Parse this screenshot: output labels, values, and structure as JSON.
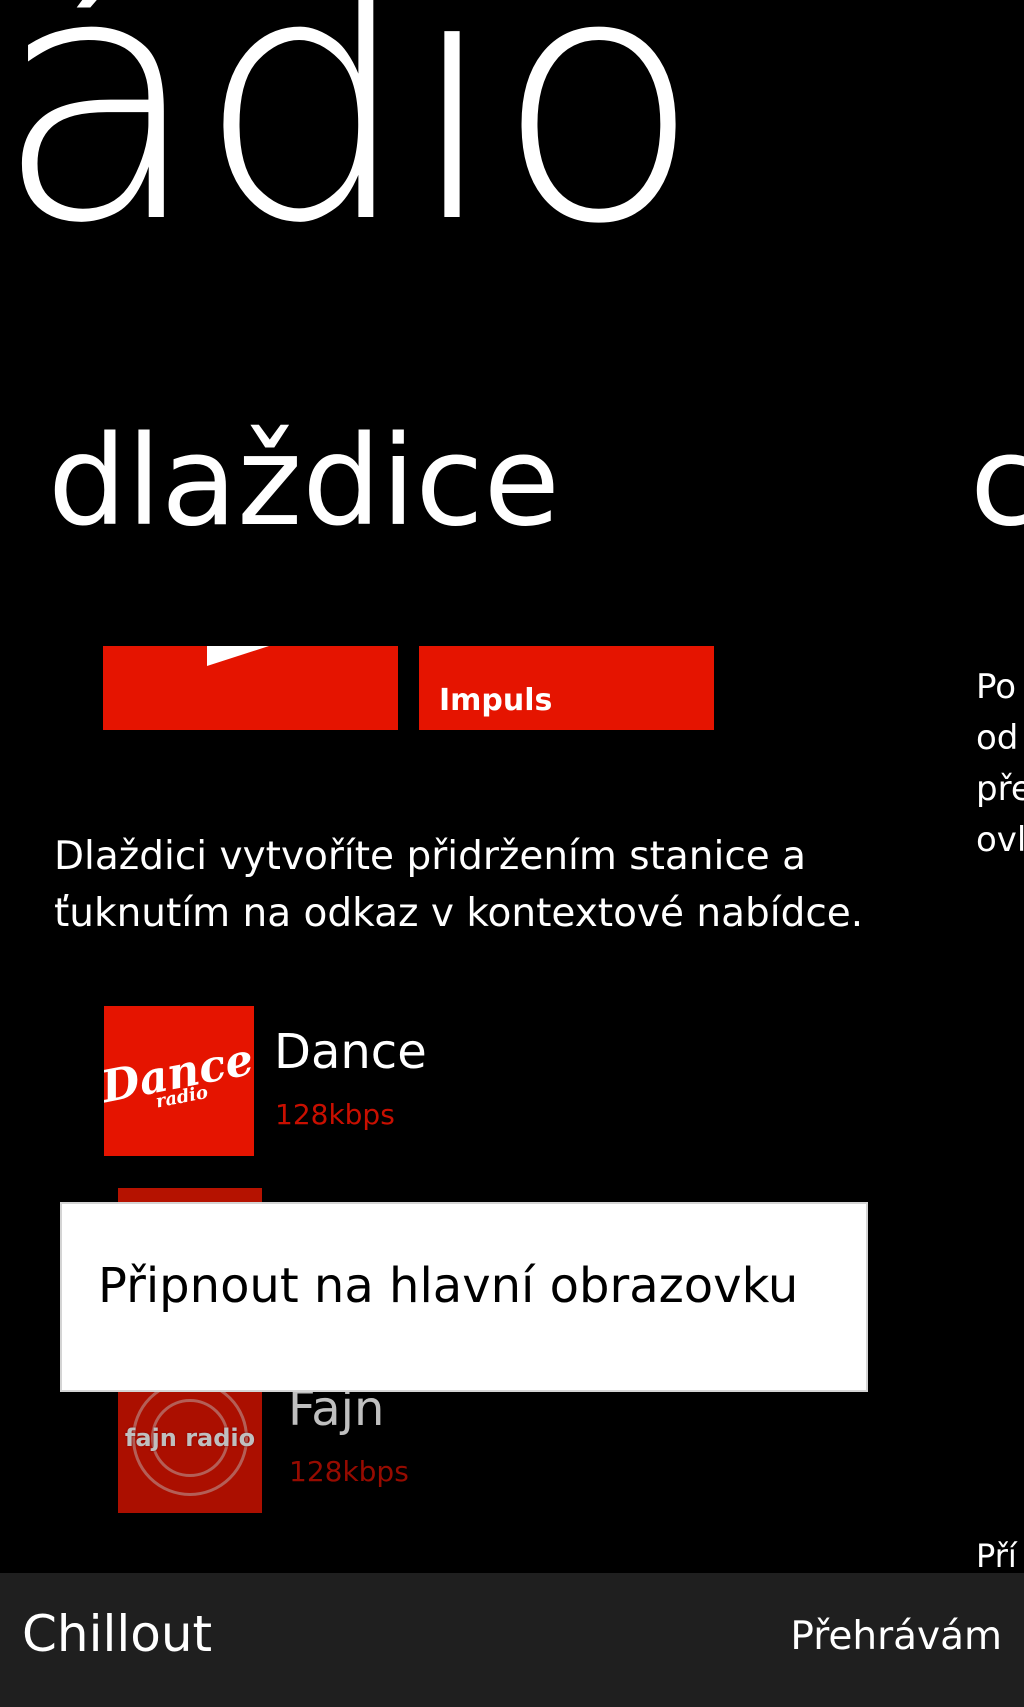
{
  "app": {
    "title": "ádio"
  },
  "panorama": {
    "current_section": "dlaždice",
    "next_section_peek": "c",
    "side_text_lines": [
      "Po",
      "od",
      "pře",
      "ovl"
    ],
    "side_footer": "Pří"
  },
  "tiles": {
    "left_tile": "",
    "right_tile_label": "Impuls",
    "accent_color": "#e51400"
  },
  "help": {
    "text": "Dlaždici vytvoříte přidržením stanice a ťuknutím na odkaz v kontextové nabídce."
  },
  "stations": [
    {
      "name": "Dance",
      "bitrate": "128kbps",
      "logo_text": "Dance",
      "logo_sub": "radio"
    },
    {
      "name": "Fajn",
      "bitrate": "128kbps",
      "logo_text": "fajn radio"
    }
  ],
  "context_menu": {
    "item": "Připnout na hlavní obrazovku"
  },
  "mini_player": {
    "station": "Chillout",
    "status": "Přehrávám"
  },
  "icons": {
    "play": "play-icon"
  }
}
